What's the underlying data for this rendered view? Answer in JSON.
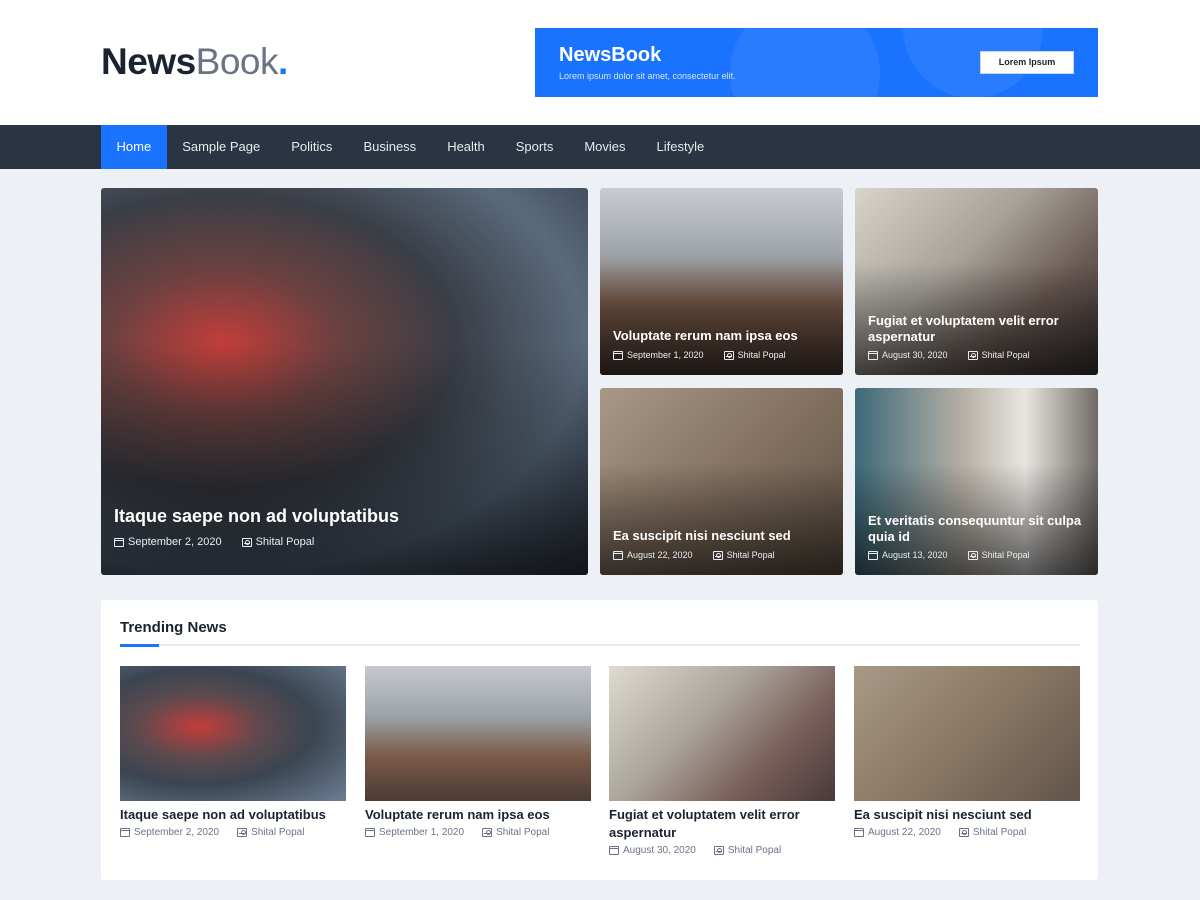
{
  "header": {
    "logo_part1": "News",
    "logo_part2": "Book",
    "logo_dot": ".",
    "ad": {
      "title": "NewsBook",
      "subtitle": "Lorem ipsum dolor sit amet, consectetur elit.",
      "button_label": "Lorem Ipsum"
    }
  },
  "nav": {
    "items": [
      {
        "label": "Home",
        "active": true
      },
      {
        "label": "Sample Page"
      },
      {
        "label": "Politics"
      },
      {
        "label": "Business"
      },
      {
        "label": "Health"
      },
      {
        "label": "Sports"
      },
      {
        "label": "Movies"
      },
      {
        "label": "Lifestyle"
      }
    ]
  },
  "featured": [
    {
      "title": "Itaque saepe non ad voluptatibus",
      "date": "September 2, 2020",
      "author": "Shital Popal"
    },
    {
      "title": "Voluptate rerum nam ipsa eos",
      "date": "September 1, 2020",
      "author": "Shital Popal"
    },
    {
      "title": "Fugiat et voluptatem velit error aspernatur",
      "date": "August 30, 2020",
      "author": "Shital Popal"
    },
    {
      "title": "Ea suscipit nisi nesciunt sed",
      "date": "August 22, 2020",
      "author": "Shital Popal"
    },
    {
      "title": "Et veritatis consequuntur sit culpa quia id",
      "date": "August 13, 2020",
      "author": "Shital Popal"
    }
  ],
  "trending": {
    "heading": "Trending News",
    "items": [
      {
        "title": "Itaque saepe non ad voluptatibus",
        "date": "September 2, 2020",
        "author": "Shital Popal"
      },
      {
        "title": "Voluptate rerum nam ipsa eos",
        "date": "September 1, 2020",
        "author": "Shital Popal"
      },
      {
        "title": "Fugiat et voluptatem velit error aspernatur",
        "date": "August 30, 2020",
        "author": "Shital Popal"
      },
      {
        "title": "Ea suscipit nisi nesciunt sed",
        "date": "August 22, 2020",
        "author": "Shital Popal"
      }
    ]
  },
  "colors": {
    "accent": "#1a73ff",
    "nav_bg": "#2b3443",
    "page_bg": "#edf1f6"
  },
  "icons": {
    "date": "calendar-icon",
    "author": "user-icon"
  }
}
